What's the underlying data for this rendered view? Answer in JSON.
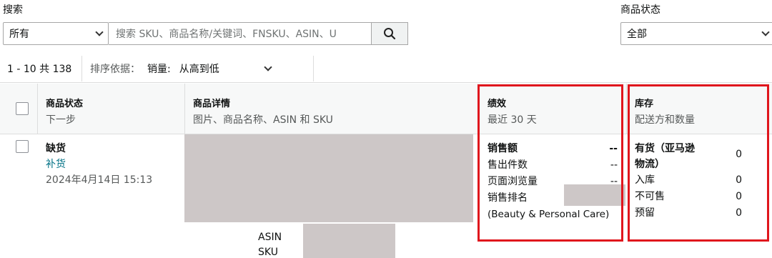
{
  "filters": {
    "search_label": "搜索",
    "scope_value": "所有",
    "search_placeholder": "搜索 SKU、商品名称/关键词、FNSKU、ASIN、U",
    "status_label": "商品状态",
    "status_value": "全部"
  },
  "sortbar": {
    "range_text": "1 - 10 共 138",
    "sort_label": "排序依据：",
    "sort_field": "销量:",
    "sort_value": "从高到低"
  },
  "columns": {
    "status": {
      "title": "商品状态",
      "sub": "下一步"
    },
    "details": {
      "title": "商品详情",
      "sub": "图片、商品名称、ASIN 和 SKU"
    },
    "performance": {
      "title": "绩效",
      "sub": "最近 30 天"
    },
    "inventory": {
      "title": "库存",
      "sub": "配送方和数量"
    }
  },
  "row": {
    "status": "缺货",
    "action": "补货",
    "date": "2024年4月14日 15:13",
    "asin_label": "ASIN",
    "sku_label": "SKU",
    "performance": {
      "sales_label": "销售额",
      "sales_value": "--",
      "units_label": "售出件数",
      "units_value": "--",
      "views_label": "页面浏览量",
      "views_value": "--",
      "rank_label": "销售排名",
      "category": "(Beauty & Personal Care)"
    },
    "inventory": {
      "fba_label_1": "有货（亚马逊",
      "fba_label_2": "物流）",
      "fba_value": "0",
      "inbound_label": "入库",
      "inbound_value": "0",
      "unfulfillable_label": "不可售",
      "unfulfillable_value": "0",
      "reserved_label": "预留",
      "reserved_value": "0"
    }
  },
  "colors": {
    "highlight": "#e0161d",
    "link": "#007185"
  }
}
